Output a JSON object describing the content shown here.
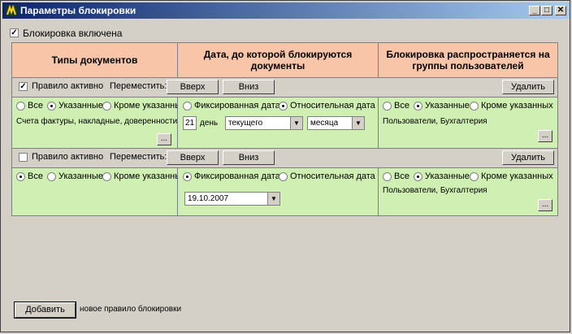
{
  "window": {
    "title": "Параметры блокировки",
    "min_glyph": "_",
    "max_glyph": "□",
    "close_glyph": "✕"
  },
  "blocking_enabled": {
    "label": "Блокировка включена",
    "checked": true
  },
  "headers": [
    "Типы документов",
    "Дата, до которой блокируются документы",
    "Блокировка распространяется на группы пользователей"
  ],
  "rules": [
    {
      "active_label": "Правило активно",
      "active": true,
      "move_label": "Переместить:",
      "up_label": "Вверх",
      "down_label": "Вниз",
      "delete_label": "Удалить",
      "doc_types": {
        "all": "Все",
        "specified": "Указанные",
        "except": "Кроме указанных",
        "selected": "specified",
        "text": "Счета фактуры, накладные, доверенности."
      },
      "date": {
        "fixed": "Фиксированная дата",
        "relative": "Относительная дата",
        "selected": "relative",
        "day_value": "21",
        "day_label": "день",
        "period": "текущего",
        "unit": "месяца"
      },
      "groups": {
        "all": "Все",
        "specified": "Указанные",
        "except": "Кроме указанных",
        "selected": "specified",
        "text": "Пользователи, Бухгалтерия"
      },
      "ellipsis": "..."
    },
    {
      "active_label": "Правило активно",
      "active": false,
      "move_label": "Переместить:",
      "up_label": "Вверх",
      "down_label": "Вниз",
      "delete_label": "Удалить",
      "doc_types": {
        "all": "Все",
        "specified": "Указанные",
        "except": "Кроме указанных",
        "selected": "all",
        "text": ""
      },
      "date": {
        "fixed": "Фиксированная дата",
        "relative": "Относительная дата",
        "selected": "fixed",
        "date_value": "19.10.2007"
      },
      "groups": {
        "all": "Все",
        "specified": "Указанные",
        "except": "Кроме указанных",
        "selected": "specified",
        "text": "Пользователи, Бухгалтерия"
      },
      "ellipsis": "..."
    }
  ],
  "footer": {
    "add_label": "Добавить",
    "add_hint": "новое правило блокировки"
  },
  "colors": {
    "header_bg": "#f9c5a8",
    "cell_bg": "#cff0b2",
    "title_start": "#0a246a",
    "title_end": "#a6caf0"
  }
}
